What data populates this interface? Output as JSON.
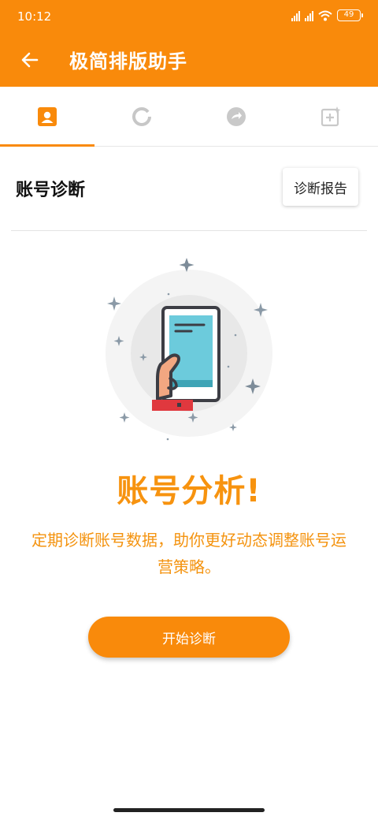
{
  "status_bar": {
    "time": "10:12",
    "battery": "49",
    "icons": [
      "signal-hd-icon",
      "signal-hd-icon",
      "wifi-icon",
      "battery-icon"
    ]
  },
  "app_bar": {
    "title": "极简排版助手",
    "background": "#f98a0b",
    "back_icon": "arrow-left-icon"
  },
  "tabs": [
    {
      "icon": "account-card-icon",
      "active": true
    },
    {
      "icon": "loading-ring-icon",
      "active": false
    },
    {
      "icon": "share-arrow-circle-icon",
      "active": false
    },
    {
      "icon": "add-square-sparkle-icon",
      "active": false
    }
  ],
  "section": {
    "title": "账号诊断",
    "report_button": "诊断报告"
  },
  "hero": {
    "illustration_icon": "phone-in-hand-illustration",
    "headline": "账号分析!",
    "description": "定期诊断账号数据，助你更好动态调整账号运营策略。"
  },
  "start_button": "开始诊断",
  "colors": {
    "accent": "#f98a0b",
    "accent_text": "#f7930f"
  }
}
